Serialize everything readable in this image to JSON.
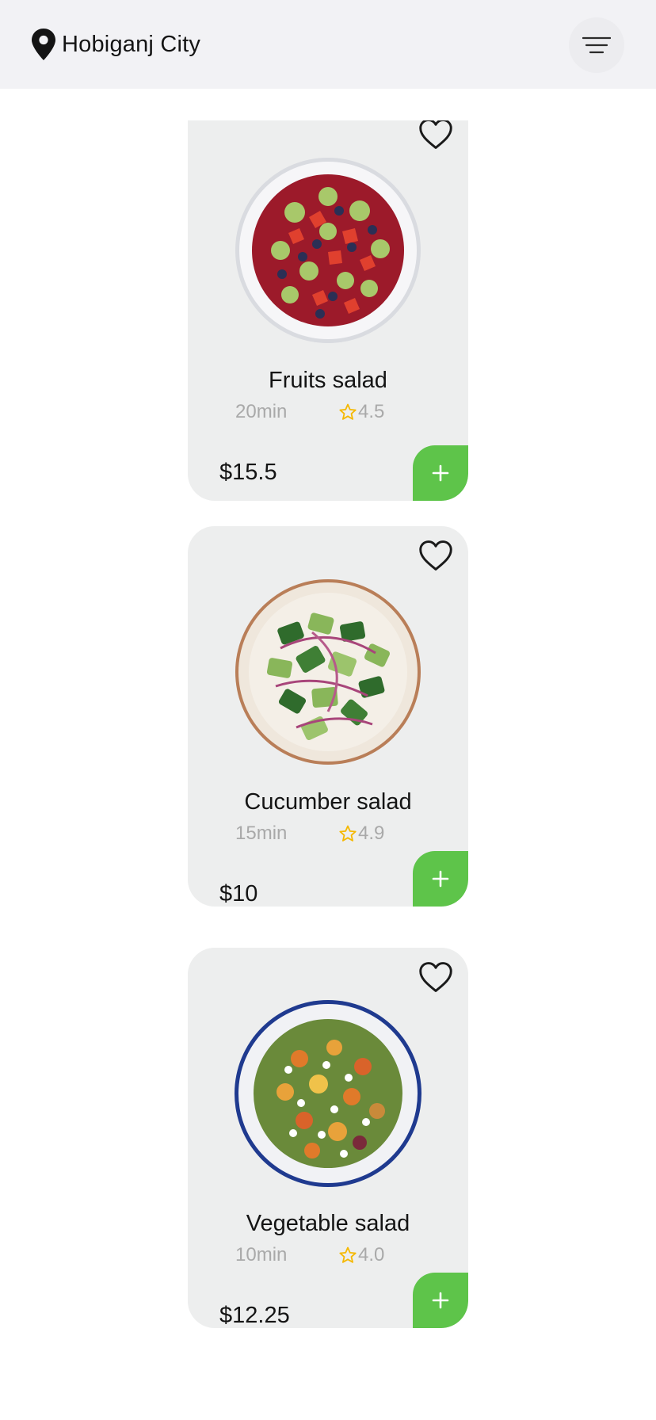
{
  "header": {
    "location_label": "Hobiganj City",
    "location_icon": "map-pin-icon",
    "menu_icon": "menu-icon"
  },
  "colors": {
    "add_button": "#5ec44a",
    "star": "#f5b800",
    "card_background": "#edeeee",
    "header_background": "#f2f2f5"
  },
  "foods": [
    {
      "name": "Fruits salad",
      "duration": "20min",
      "rating": "4.5",
      "price": "$15.5",
      "image": "fruits-salad-bowl"
    },
    {
      "name": "Cucumber salad",
      "duration": "15min",
      "rating": "4.9",
      "price": "$10",
      "image": "cucumber-salad-bowl"
    },
    {
      "name": "Vegetable salad",
      "duration": "10min",
      "rating": "4.0",
      "price": "$12.25",
      "image": "vegetable-salad-bowl"
    }
  ]
}
